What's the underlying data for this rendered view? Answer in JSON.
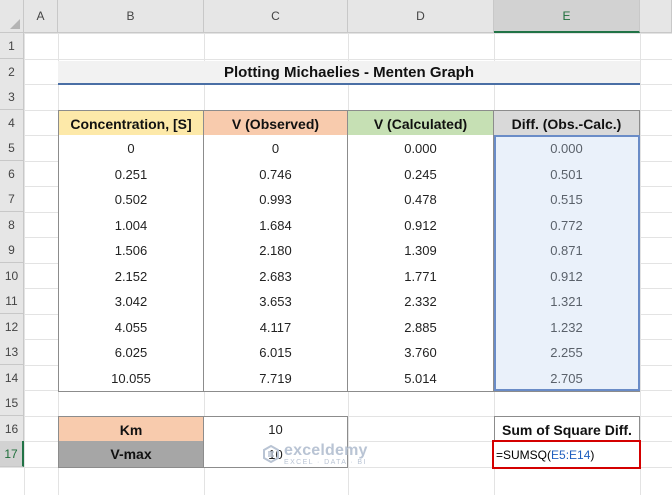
{
  "columns": [
    "A",
    "B",
    "C",
    "D",
    "E"
  ],
  "selected_column": "E",
  "rows": [
    "1",
    "2",
    "3",
    "4",
    "5",
    "6",
    "7",
    "8",
    "9",
    "10",
    "11",
    "12",
    "13",
    "14",
    "15",
    "16",
    "17"
  ],
  "selected_row": "17",
  "title": "Plotting Michaelies - Menten Graph",
  "table": {
    "headers": [
      "Concentration, [S]",
      "V (Observed)",
      "V (Calculated)",
      "Diff. (Obs.-Calc.)"
    ],
    "header_colors": [
      "#fde9a9",
      "#f8cbad",
      "#c6e0b4",
      "#d9d9d9"
    ],
    "rows": [
      [
        "0",
        "0",
        "0.000",
        "0.000"
      ],
      [
        "0.251",
        "0.746",
        "0.245",
        "0.501"
      ],
      [
        "0.502",
        "0.993",
        "0.478",
        "0.515"
      ],
      [
        "1.004",
        "1.684",
        "0.912",
        "0.772"
      ],
      [
        "1.506",
        "2.180",
        "1.309",
        "0.871"
      ],
      [
        "2.152",
        "2.683",
        "1.771",
        "0.912"
      ],
      [
        "3.042",
        "3.653",
        "2.332",
        "1.321"
      ],
      [
        "4.055",
        "4.117",
        "2.885",
        "1.232"
      ],
      [
        "6.025",
        "6.015",
        "3.760",
        "2.255"
      ],
      [
        "10.055",
        "7.719",
        "5.014",
        "2.705"
      ]
    ]
  },
  "params": {
    "km_label": "Km",
    "km_value": "10",
    "vmax_label": "V-max",
    "vmax_value": "10",
    "km_color": "#f8cbad",
    "vmax_color": "#a6a6a6"
  },
  "sum_box": {
    "label": "Sum of Square Diff.",
    "formula_prefix": "=SUMSQ(",
    "formula_ref": "E5:E14",
    "formula_suffix": ")"
  },
  "watermark": {
    "brand": "exceldemy",
    "tagline": "EXCEL · DATA · BI"
  }
}
